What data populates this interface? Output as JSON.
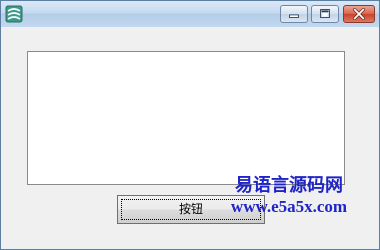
{
  "window": {
    "title_icon": "app-icon",
    "controls": [
      "minimize-icon",
      "maximize-icon",
      "close-icon"
    ]
  },
  "main": {
    "textbox_value": "",
    "button_label": "按钮"
  },
  "watermark": {
    "title": "易语言源码网",
    "url": "www.e5a5x.com"
  },
  "colors": {
    "watermark": "#1f24c8",
    "close_button": "#c9432a",
    "titlebar": "#c6daf0"
  }
}
